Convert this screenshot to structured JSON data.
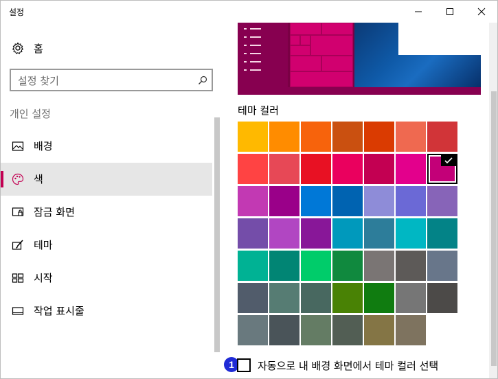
{
  "window": {
    "title": "설정"
  },
  "sidebar": {
    "home_label": "홈",
    "search_placeholder": "설정 찾기",
    "section_title": "개인 설정",
    "items": [
      {
        "label": "배경",
        "icon": "picture-icon",
        "selected": false
      },
      {
        "label": "색",
        "icon": "palette-icon",
        "selected": true
      },
      {
        "label": "잠금 화면",
        "icon": "lock-screen-icon",
        "selected": false
      },
      {
        "label": "테마",
        "icon": "theme-brush-icon",
        "selected": false
      },
      {
        "label": "시작",
        "icon": "start-tiles-icon",
        "selected": false
      },
      {
        "label": "작업 표시줄",
        "icon": "taskbar-icon",
        "selected": false
      }
    ]
  },
  "main": {
    "theme_color_label": "테마 컬러",
    "selected_color": "#C30078",
    "colors": [
      [
        "#FFB900",
        "#FF8C00",
        "#F7630C",
        "#CA5010",
        "#DA3B01",
        "#EF6950",
        "#D13438"
      ],
      [
        "#FF4343",
        "#E74856",
        "#E81123",
        "#EA005E",
        "#C30052",
        "#E3008C",
        "#C30078"
      ],
      [
        "#C239B3",
        "#9A0089",
        "#0078D7",
        "#0063B1",
        "#8E8CD8",
        "#6B69D6",
        "#8764B8"
      ],
      [
        "#744DA9",
        "#B146C2",
        "#881798",
        "#0099BC",
        "#2D7D9A",
        "#00B7C3",
        "#038387"
      ],
      [
        "#00B294",
        "#018574",
        "#00CC6A",
        "#10893E",
        "#7A7574",
        "#5D5A58",
        "#68768A"
      ],
      [
        "#515C6B",
        "#567C73",
        "#486860",
        "#498205",
        "#107C10",
        "#767676",
        "#4C4A48"
      ],
      [
        "#69797E",
        "#4A5459",
        "#647C64",
        "#525E54",
        "#847545",
        "#7E735F"
      ]
    ],
    "auto_pick_badge": "1",
    "auto_pick_label": "자동으로 내 배경 화면에서 테마 컬러 선택"
  },
  "accent_color": "#C30052"
}
